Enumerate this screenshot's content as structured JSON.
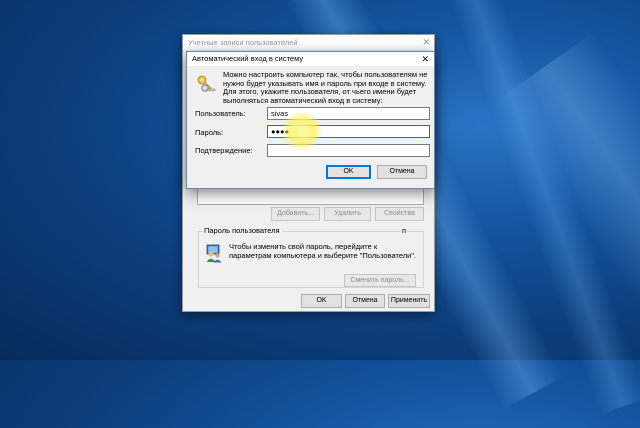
{
  "back_window": {
    "title": "Учетные записи пользователей",
    "close_glyph": "✕",
    "buttons": {
      "add": "Добавить...",
      "remove": "Удалить",
      "properties": "Свойства"
    },
    "password_group": {
      "legend": "Пароль пользователя",
      "legend_end": "п",
      "text": "Чтобы изменить свой пароль, перейдите к параметрам компьютера и выберите \"Пользователи\".",
      "change_button": "Сменить пароль..."
    },
    "footer": {
      "ok": "OK",
      "cancel": "Отмена",
      "apply": "Применить"
    },
    "icons": {
      "users": "users-icon"
    }
  },
  "dialog": {
    "title": "Автоматический вход в систему",
    "close_glyph": "✕",
    "description": "Можно настроить компьютер так, чтобы пользователям не нужно будет указывать имя и пароль при входе в систему. Для этого, укажите пользователя, от чьего имени будет выполняться автоматический вход в систему:",
    "fields": {
      "username_label": "Пользователь:",
      "username_value": "sivas",
      "password_label": "Пароль:",
      "password_value": "●●●●",
      "confirm_label": "Подтверждение:",
      "confirm_value": ""
    },
    "buttons": {
      "ok": "OK",
      "cancel": "Отмена"
    },
    "icons": {
      "keys": "keys-icon"
    }
  },
  "colors": {
    "desktop": "#0c3f7e",
    "focus": "#0078d7",
    "cursor_highlight": "#fff06a"
  }
}
